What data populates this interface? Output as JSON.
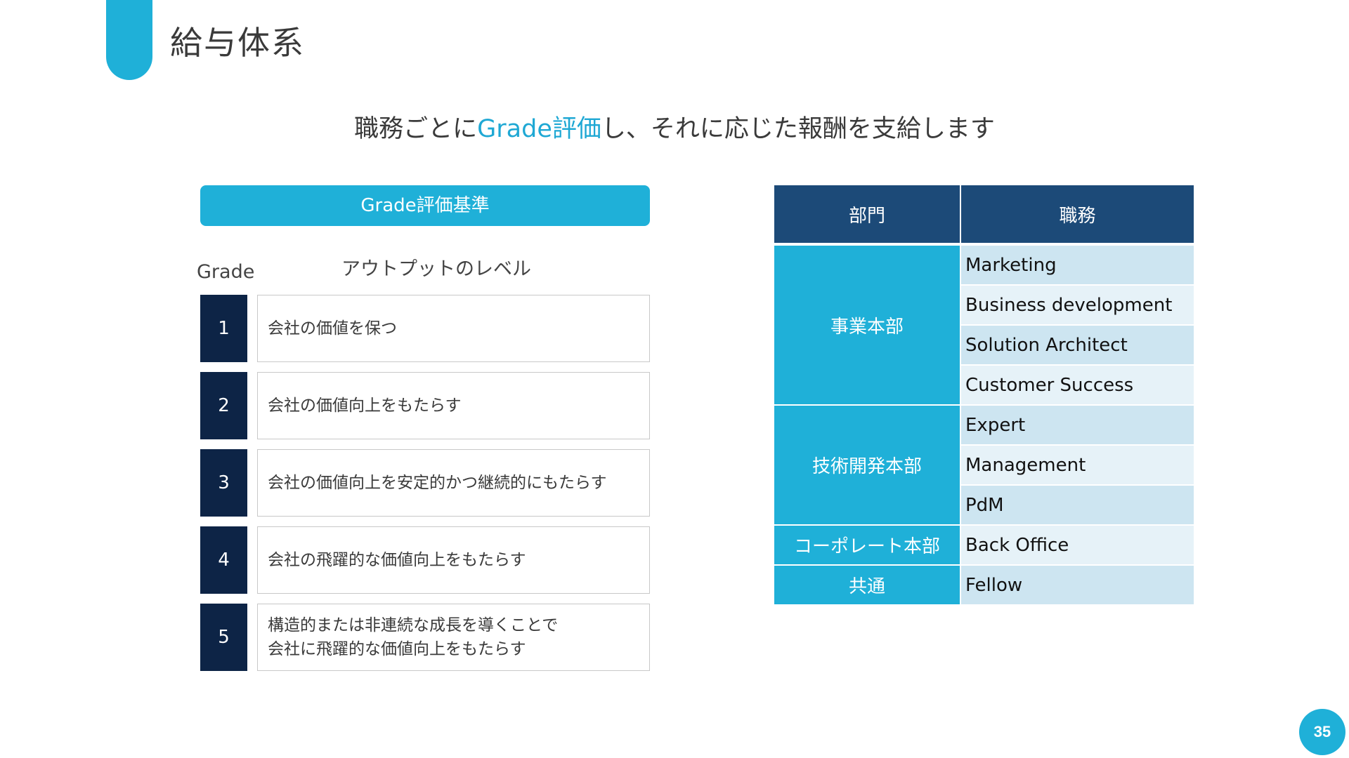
{
  "page": {
    "title": "給与体系",
    "subtitle_before": "職務ごとに",
    "subtitle_highlight": "Grade評価",
    "subtitle_after": "し、それに応じた報酬を支給します",
    "page_number": "35"
  },
  "criteria": {
    "header": "Grade評価基準",
    "col_grade": "Grade",
    "col_level": "アウトプットのレベル",
    "rows": [
      {
        "grade": "1",
        "lines": [
          "会社の価値を保つ"
        ]
      },
      {
        "grade": "2",
        "lines": [
          "会社の価値向上をもたらす"
        ]
      },
      {
        "grade": "3",
        "lines": [
          "会社の価値向上を安定的かつ継続的にもたらす"
        ]
      },
      {
        "grade": "4",
        "lines": [
          "会社の飛躍的な価値向上をもたらす"
        ]
      },
      {
        "grade": "5",
        "lines": [
          "構造的または非連続な成長を導くことで",
          "会社に飛躍的な価値向上をもたらす"
        ]
      }
    ]
  },
  "roles": {
    "header_dept": "部門",
    "header_job": "職務",
    "groups": [
      {
        "dept": "事業本部",
        "jobs": [
          "Marketing",
          "Business development",
          "Solution Architect",
          "Customer Success"
        ]
      },
      {
        "dept": "技術開発本部",
        "jobs": [
          "Expert",
          "Management",
          "PdM"
        ]
      },
      {
        "dept": "コーポレート本部",
        "jobs": [
          "Back Office"
        ]
      },
      {
        "dept": "共通",
        "jobs": [
          "Fellow"
        ]
      }
    ]
  },
  "colors": {
    "accent": "#1fb0d8",
    "navy": "#0d2446",
    "table_header": "#1c4a78",
    "row_dark": "#cde5f1",
    "row_light": "#e6f2f8"
  }
}
